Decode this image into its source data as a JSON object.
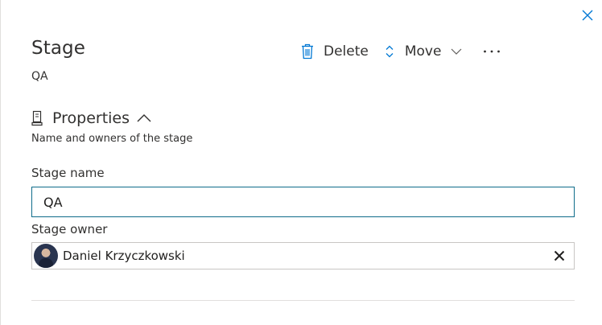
{
  "panel": {
    "title": "Stage",
    "subtitle": "QA"
  },
  "toolbar": {
    "delete_label": "Delete",
    "move_label": "Move",
    "more_label": "···"
  },
  "properties": {
    "header": "Properties",
    "description": "Name and owners of the stage",
    "stage_name_label": "Stage name",
    "stage_name_value": "QA",
    "stage_owner_label": "Stage owner",
    "owner": {
      "name": "Daniel Krzyczkowski"
    }
  },
  "icons": {
    "close": "close-icon",
    "delete": "trash-icon",
    "move": "up-down-arrows-icon",
    "move_dropdown": "chevron-down-icon",
    "more": "more-icon",
    "properties": "properties-icon",
    "collapse": "chevron-up-icon",
    "remove_owner": "close-icon"
  },
  "colors": {
    "accent": "#0078d4",
    "input_focus_border": "#0f6c8a",
    "text": "#323130"
  }
}
